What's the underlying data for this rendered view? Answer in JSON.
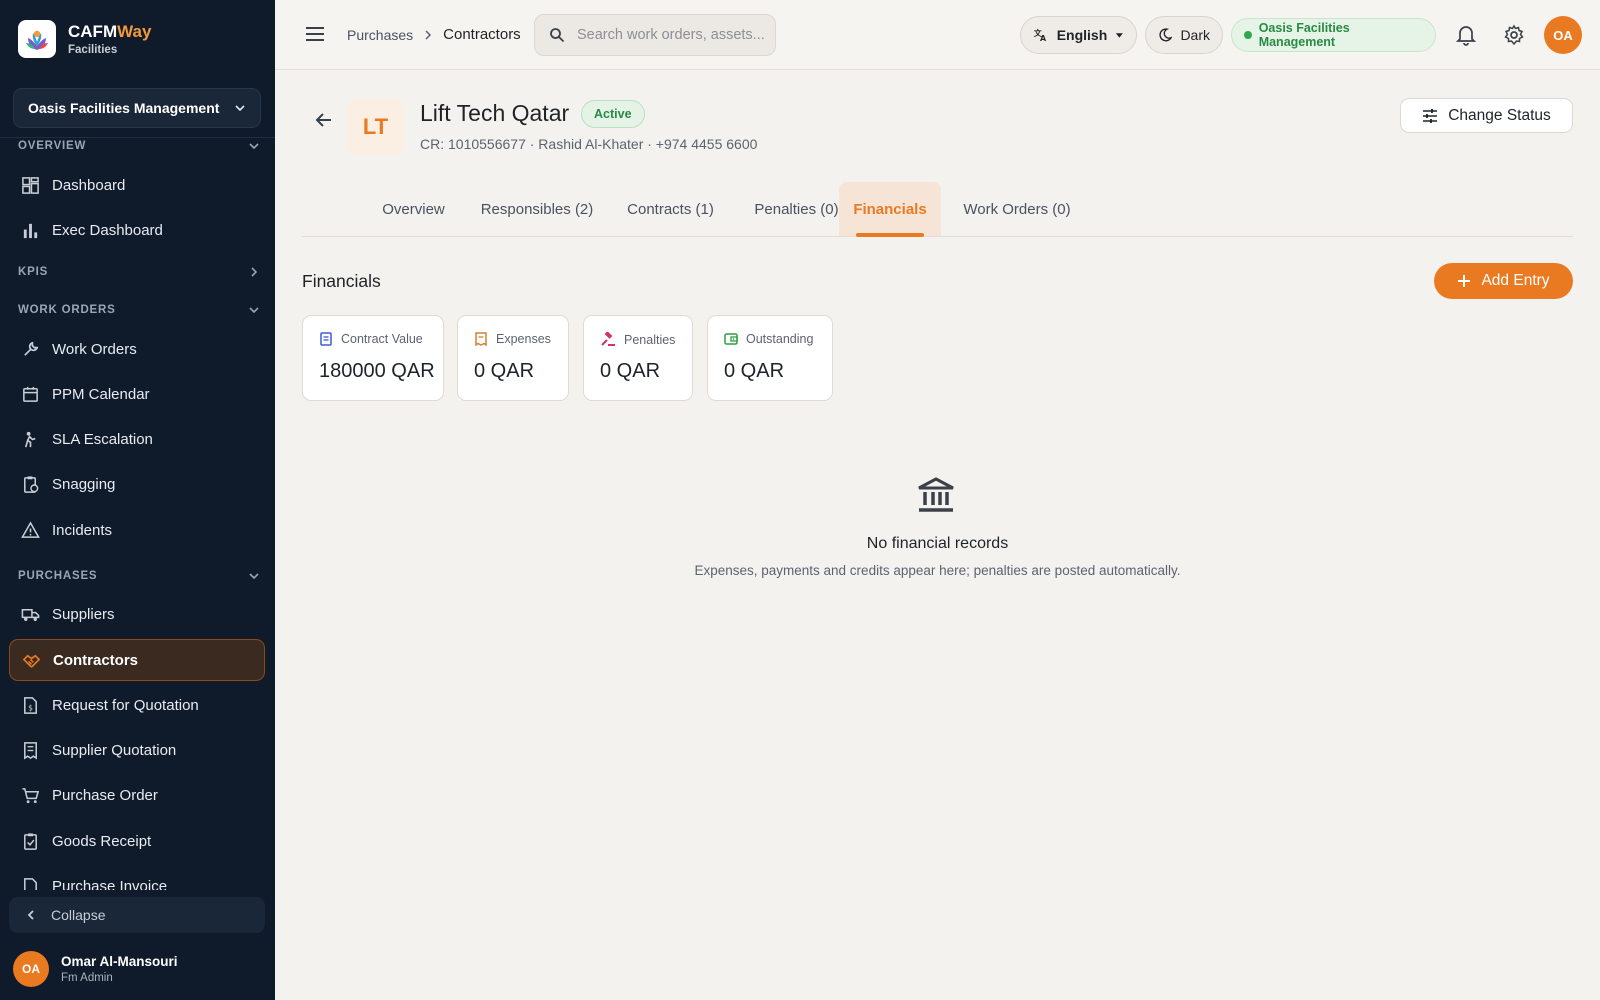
{
  "brand": {
    "name_main": "CAFM",
    "name_accent": "Way",
    "subtitle": "Facilities"
  },
  "sidebar": {
    "org_selector": "Oasis Facilities Management",
    "sections": {
      "overview": "OVERVIEW",
      "kpis": "KPIS",
      "work_orders": "WORK ORDERS",
      "purchases": "PURCHASES"
    },
    "items": {
      "dashboard": "Dashboard",
      "exec_dashboard": "Exec Dashboard",
      "work_orders": "Work Orders",
      "ppm_calendar": "PPM Calendar",
      "sla_escalation": "SLA Escalation",
      "snagging": "Snagging",
      "incidents": "Incidents",
      "suppliers": "Suppliers",
      "contractors": "Contractors",
      "rfq": "Request for Quotation",
      "supplier_quotation": "Supplier Quotation",
      "purchase_order": "Purchase Order",
      "goods_receipt": "Goods Receipt",
      "purchase_invoice": "Purchase Invoice"
    },
    "collapse": "Collapse",
    "user": {
      "initials": "OA",
      "name": "Omar Al-Mansouri",
      "role": "Fm Admin"
    }
  },
  "topbar": {
    "breadcrumb": {
      "parent": "Purchases",
      "current": "Contractors"
    },
    "search_placeholder": "Search work orders, assets...",
    "language": "English",
    "theme": "Dark",
    "org": "Oasis Facilities Management",
    "avatar": "OA"
  },
  "entity": {
    "initials": "LT",
    "name": "Lift Tech Qatar",
    "status": "Active",
    "meta": "CR: 1010556677 · Rashid Al-Khater · +974 4455 6600",
    "change_status": "Change Status"
  },
  "tabs": {
    "overview": "Overview",
    "responsibles": "Responsibles (2)",
    "contracts": "Contracts (1)",
    "penalties": "Penalties (0)",
    "financials": "Financials",
    "work_orders": "Work Orders (0)"
  },
  "financials": {
    "title": "Financials",
    "add_entry": "Add Entry",
    "cards": {
      "contract_value": {
        "label": "Contract Value",
        "value": "180000 QAR"
      },
      "expenses": {
        "label": "Expenses",
        "value": "0 QAR"
      },
      "penalties": {
        "label": "Penalties",
        "value": "0 QAR"
      },
      "outstanding": {
        "label": "Outstanding",
        "value": "0 QAR"
      }
    },
    "empty": {
      "title": "No financial records",
      "subtitle": "Expenses, payments and credits appear here; penalties are posted automatically."
    }
  },
  "colors": {
    "accent": "#ea7a22",
    "sidebar": "#0f1b2b",
    "success": "#2a8a44"
  }
}
